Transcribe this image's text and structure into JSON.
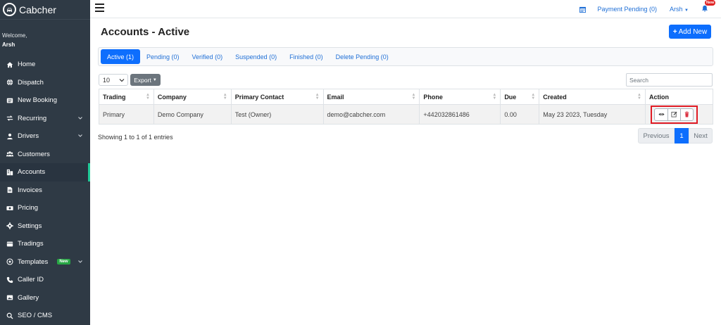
{
  "app": {
    "name": "Cabcher"
  },
  "sidebar": {
    "welcome_label": "Welcome,",
    "user_name": "Arsh",
    "items": [
      {
        "label": "Home",
        "icon": "home-icon"
      },
      {
        "label": "Dispatch",
        "icon": "globe-icon"
      },
      {
        "label": "New Booking",
        "icon": "booking-icon"
      },
      {
        "label": "Recurring",
        "icon": "recurring-icon",
        "has_submenu": true
      },
      {
        "label": "Drivers",
        "icon": "driver-icon",
        "has_submenu": true
      },
      {
        "label": "Customers",
        "icon": "users-icon"
      },
      {
        "label": "Accounts",
        "icon": "accounts-icon",
        "active": true
      },
      {
        "label": "Invoices",
        "icon": "invoice-icon"
      },
      {
        "label": "Pricing",
        "icon": "pricing-icon"
      },
      {
        "label": "Settings",
        "icon": "gear-icon"
      },
      {
        "label": "Tradings",
        "icon": "tradings-icon"
      },
      {
        "label": "Templates",
        "icon": "at-icon",
        "badge": "New",
        "has_submenu": true
      },
      {
        "label": "Caller ID",
        "icon": "phone-icon"
      },
      {
        "label": "Gallery",
        "icon": "gallery-icon"
      },
      {
        "label": "SEO / CMS",
        "icon": "seo-icon"
      }
    ]
  },
  "topbar": {
    "payment_pending": "Payment Pending (0)",
    "user": "Arsh",
    "notification_badge": "New"
  },
  "page": {
    "title": "Accounts - Active",
    "add_button": "Add New"
  },
  "tabs": [
    {
      "label": "Active (1)",
      "active": true
    },
    {
      "label": "Pending (0)"
    },
    {
      "label": "Verified (0)"
    },
    {
      "label": "Suspended (0)"
    },
    {
      "label": "Finished (0)"
    },
    {
      "label": "Delete Pending (0)"
    }
  ],
  "controls": {
    "page_length": "10",
    "export_label": "Export",
    "search_placeholder": "Search"
  },
  "table": {
    "columns": [
      "Trading",
      "Company",
      "Primary Contact",
      "Email",
      "Phone",
      "Due",
      "Created",
      "Action"
    ],
    "rows": [
      {
        "trading": "Primary",
        "company": "Demo Company",
        "contact": "Test (Owner)",
        "email": "demo@cabcher.com",
        "phone": "+442032861486",
        "due": "0.00",
        "created": "May 23 2023, Tuesday"
      }
    ]
  },
  "footer": {
    "showing": "Showing 1 to 1 of 1 entries",
    "previous": "Previous",
    "current_page": "1",
    "next": "Next"
  },
  "colors": {
    "sidebar_bg": "#2f3a45",
    "accent": "#0d6efd",
    "active_indicator": "#20c997",
    "highlight_box": "#e01b24",
    "delete": "#dc3545"
  }
}
